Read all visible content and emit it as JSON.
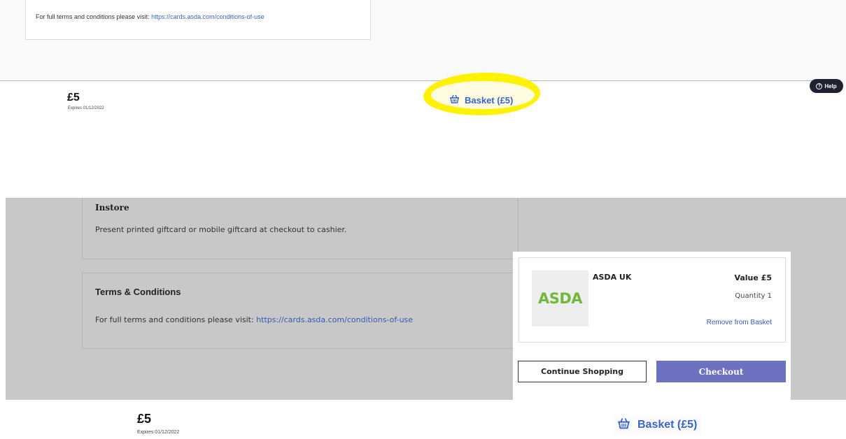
{
  "top": {
    "terms_text": "For full terms and conditions please visit: ",
    "terms_link": "https://cards.asda.com/conditions-of-use",
    "price": "£5",
    "expiry": "Expires 01/12/2022",
    "basket_label": "Basket (£5)",
    "help_label": "Help",
    "highlight_color": "#fff200"
  },
  "page": {
    "instore_title": "Instore",
    "instore_text": "Present printed giftcard or mobile giftcard at checkout to cashier.",
    "terms_title": "Terms & Conditions",
    "terms_text": "For full terms and conditions please visit: ",
    "terms_link": "https://cards.asda.com/conditions-of-use"
  },
  "basket_modal": {
    "logo_text": "ASDA",
    "item_name": "ASDA UK",
    "value": "Value £5",
    "quantity": "Quantity 1",
    "remove_label": "Remove from Basket",
    "continue_label": "Continue Shopping",
    "checkout_label": "Checkout",
    "checkout_color": "#6c72bf"
  },
  "bottom": {
    "price": "£5",
    "expiry": "Expires 01/12/2022",
    "basket_label": "Basket (£5)"
  },
  "icons": [
    "basket-icon",
    "help-icon"
  ]
}
